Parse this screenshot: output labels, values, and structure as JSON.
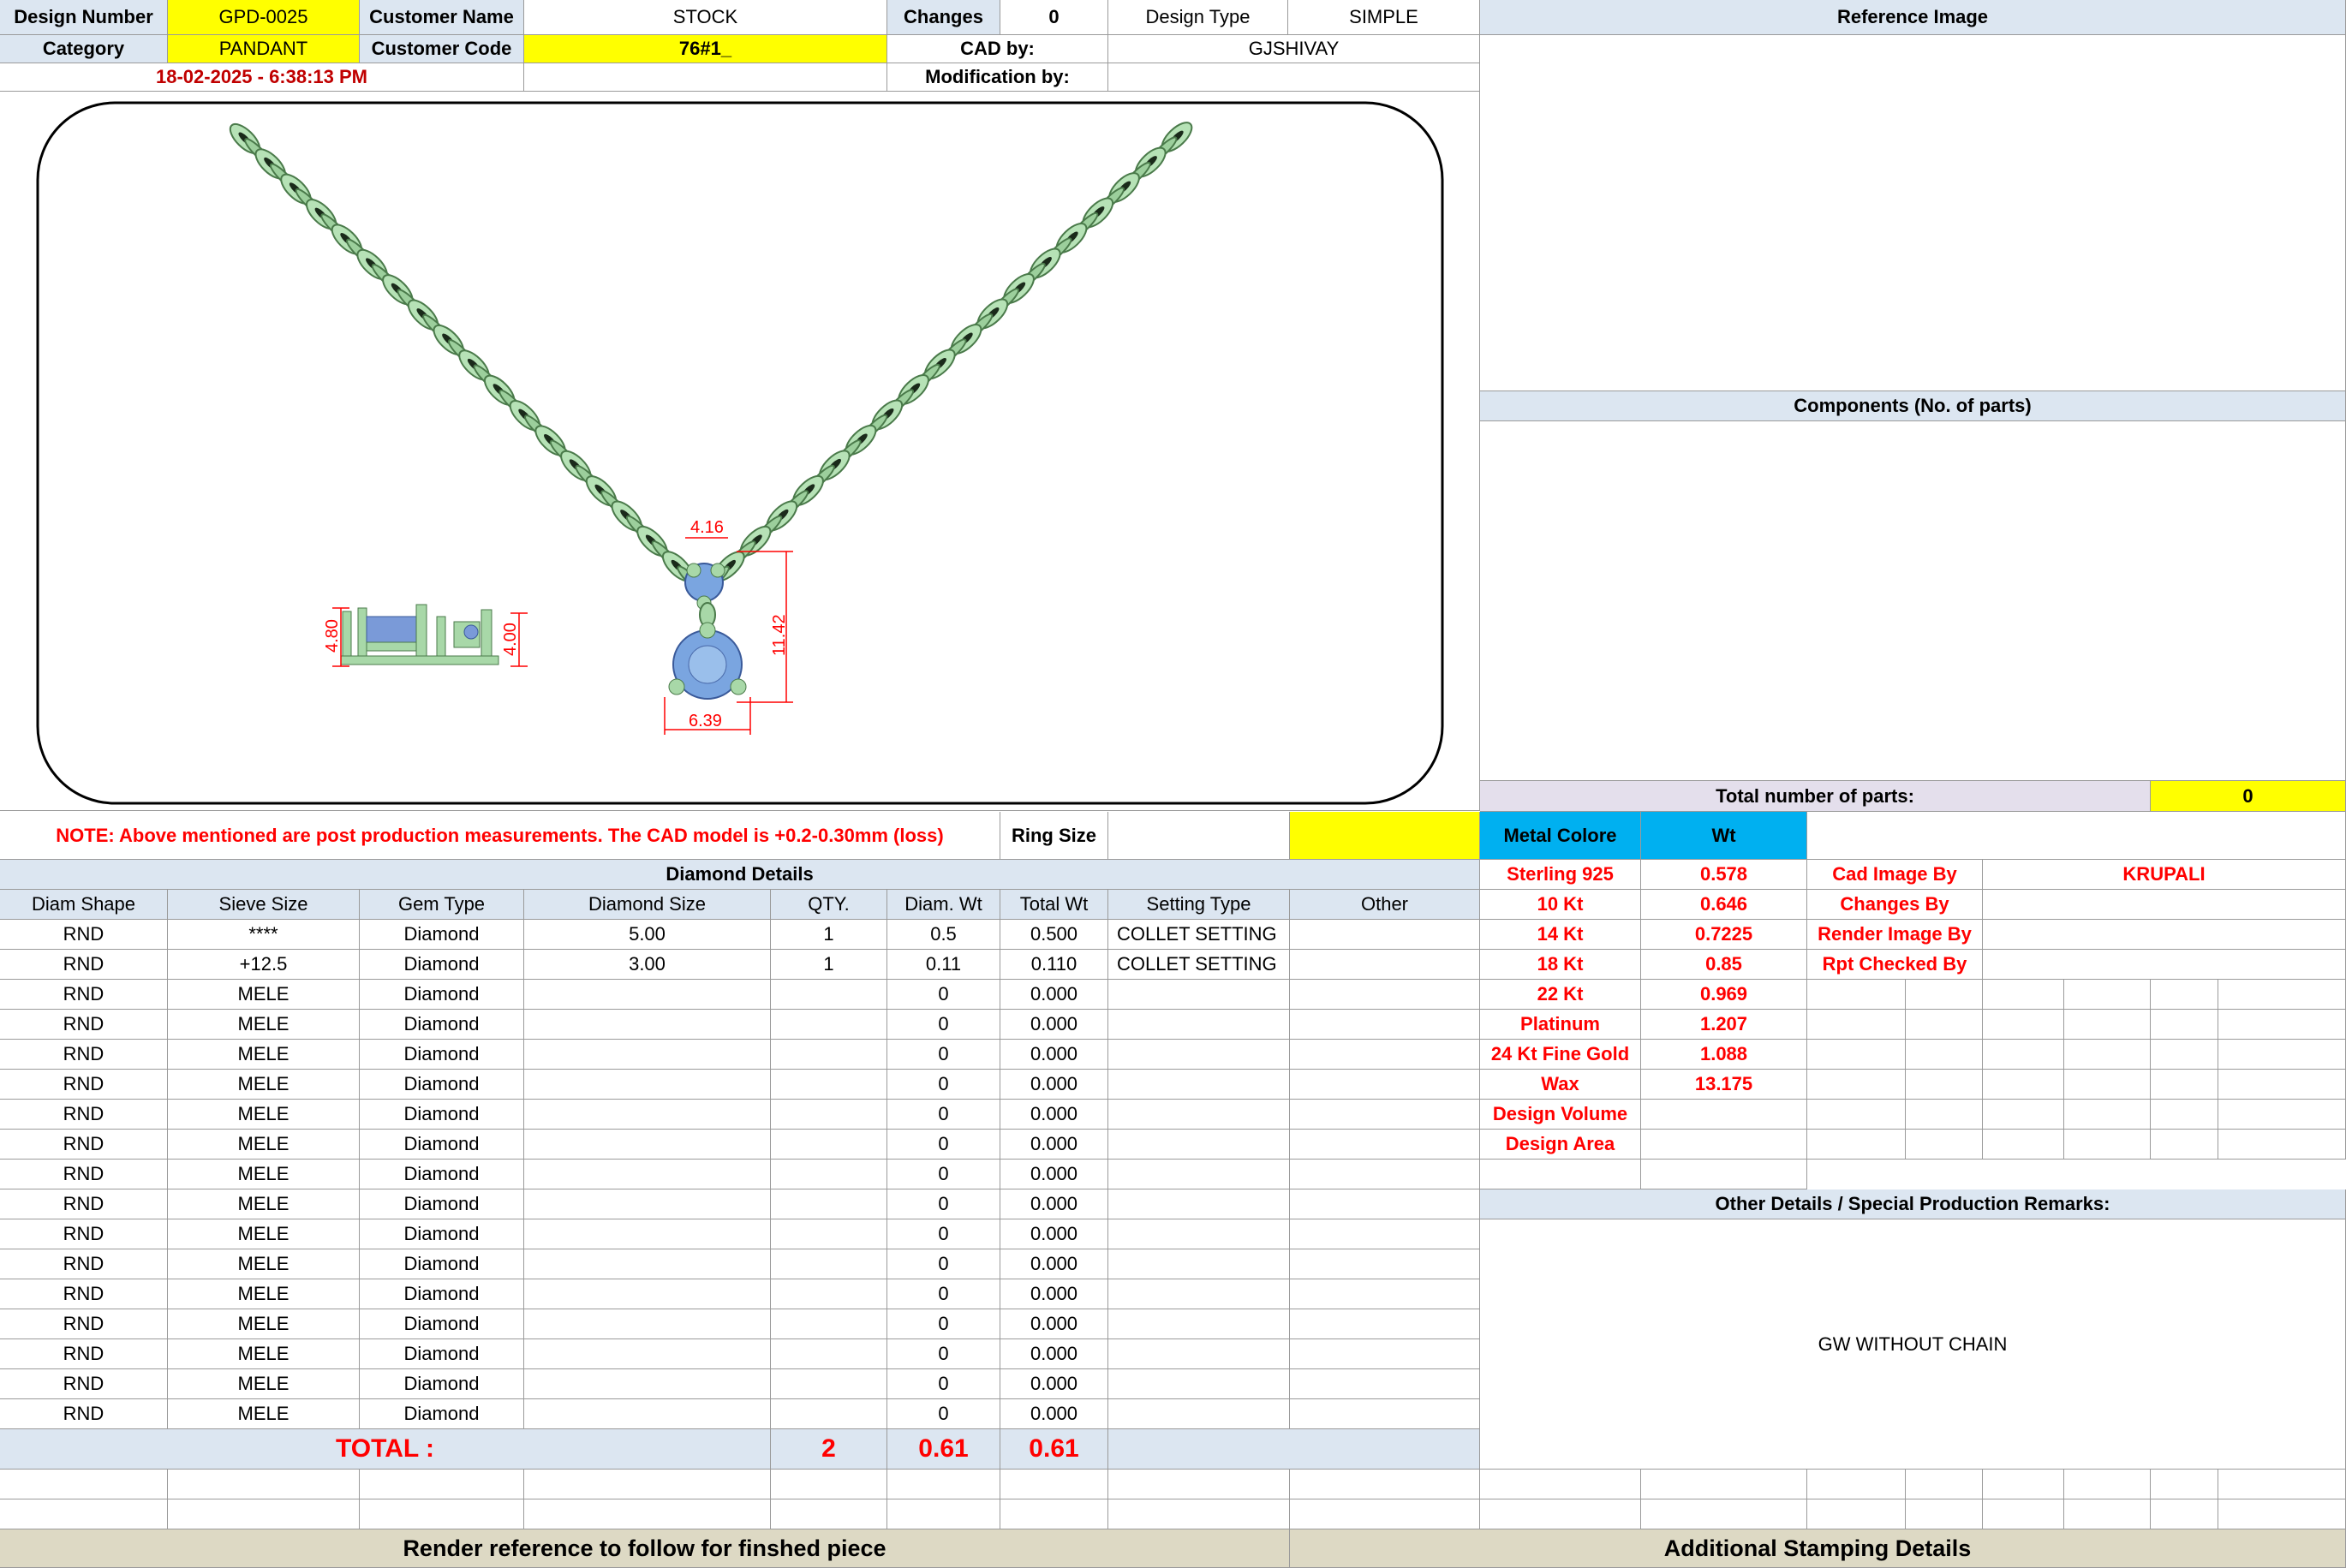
{
  "header": {
    "design_number_label": "Design Number",
    "design_number": "GPD-0025",
    "customer_name_label": "Customer Name",
    "customer_name": "STOCK",
    "changes_label": "Changes",
    "changes": "0",
    "design_type_label": "Design Type",
    "design_type": "SIMPLE",
    "category_label": "Category",
    "category": "PANDANT",
    "customer_code_label": "Customer Code",
    "customer_code": "76#1_",
    "cad_by_label": "CAD by:",
    "cad_by": "GJSHIVAY",
    "date": "18-02-2025 - 6:38:13 PM",
    "modification_by_label": "Modification by:"
  },
  "drawing": {
    "dims": [
      "4.16",
      "11.42",
      "6.39",
      "4.80",
      "4.00"
    ]
  },
  "note": "NOTE: Above mentioned are post production measurements. The CAD model is +0.2-0.30mm (loss)",
  "ring_size_label": "Ring Size",
  "right_panel": {
    "reference_image": "Reference Image",
    "components": "Components (No. of parts)",
    "total_parts_label": "Total number of parts:",
    "total_parts": "0",
    "metal_colore": "Metal Colore",
    "wt": "Wt",
    "metals": [
      {
        "name": "Sterling 925",
        "wt": "0.578"
      },
      {
        "name": "10 Kt",
        "wt": "0.646"
      },
      {
        "name": "14 Kt",
        "wt": "0.7225"
      },
      {
        "name": "18 Kt",
        "wt": "0.85"
      },
      {
        "name": "22 Kt",
        "wt": "0.969"
      },
      {
        "name": "Platinum",
        "wt": "1.207"
      },
      {
        "name": "24 Kt Fine Gold",
        "wt": "1.088"
      },
      {
        "name": "Wax",
        "wt": "13.175"
      },
      {
        "name": "Design Volume",
        "wt": ""
      },
      {
        "name": "Design Area",
        "wt": ""
      }
    ],
    "cad_image_by_label": "Cad Image By",
    "cad_image_by": "KRUPALI",
    "changes_by_label": "Changes By",
    "render_image_by_label": "Render Image By",
    "rpt_checked_by_label": "Rpt Checked By",
    "other_details": "Other Details / Special Production Remarks:",
    "remarks": "GW WITHOUT CHAIN"
  },
  "diamond": {
    "title": "Diamond Details",
    "headers": [
      "Diam Shape",
      "Sieve Size",
      "Gem Type",
      "Diamond Size",
      "QTY.",
      "Diam. Wt",
      "Total Wt",
      "Setting Type",
      "Other"
    ],
    "rows": [
      [
        "RND",
        "****",
        "Diamond",
        "5.00",
        "1",
        "0.5",
        "0.500",
        "COLLET SETTING",
        ""
      ],
      [
        "RND",
        "+12.5",
        "Diamond",
        "3.00",
        "1",
        "0.11",
        "0.110",
        "COLLET SETTING",
        ""
      ],
      [
        "RND",
        "MELE",
        "Diamond",
        "",
        "",
        "0",
        "0.000",
        "",
        ""
      ],
      [
        "RND",
        "MELE",
        "Diamond",
        "",
        "",
        "0",
        "0.000",
        "",
        ""
      ],
      [
        "RND",
        "MELE",
        "Diamond",
        "",
        "",
        "0",
        "0.000",
        "",
        ""
      ],
      [
        "RND",
        "MELE",
        "Diamond",
        "",
        "",
        "0",
        "0.000",
        "",
        ""
      ],
      [
        "RND",
        "MELE",
        "Diamond",
        "",
        "",
        "0",
        "0.000",
        "",
        ""
      ],
      [
        "RND",
        "MELE",
        "Diamond",
        "",
        "",
        "0",
        "0.000",
        "",
        ""
      ],
      [
        "RND",
        "MELE",
        "Diamond",
        "",
        "",
        "0",
        "0.000",
        "",
        ""
      ],
      [
        "RND",
        "MELE",
        "Diamond",
        "",
        "",
        "0",
        "0.000",
        "",
        ""
      ],
      [
        "RND",
        "MELE",
        "Diamond",
        "",
        "",
        "0",
        "0.000",
        "",
        ""
      ],
      [
        "RND",
        "MELE",
        "Diamond",
        "",
        "",
        "0",
        "0.000",
        "",
        ""
      ],
      [
        "RND",
        "MELE",
        "Diamond",
        "",
        "",
        "0",
        "0.000",
        "",
        ""
      ],
      [
        "RND",
        "MELE",
        "Diamond",
        "",
        "",
        "0",
        "0.000",
        "",
        ""
      ],
      [
        "RND",
        "MELE",
        "Diamond",
        "",
        "",
        "0",
        "0.000",
        "",
        ""
      ],
      [
        "RND",
        "MELE",
        "Diamond",
        "",
        "",
        "0",
        "0.000",
        "",
        ""
      ],
      [
        "RND",
        "MELE",
        "Diamond",
        "",
        "",
        "0",
        "0.000",
        "",
        ""
      ]
    ],
    "total_label": "TOTAL :",
    "total_qty": "2",
    "total_diam_wt": "0.61",
    "total_wt": "0.61"
  },
  "footer": {
    "render_ref": "Render reference to follow for finshed piece",
    "stamping": "Additional Stamping Details"
  }
}
